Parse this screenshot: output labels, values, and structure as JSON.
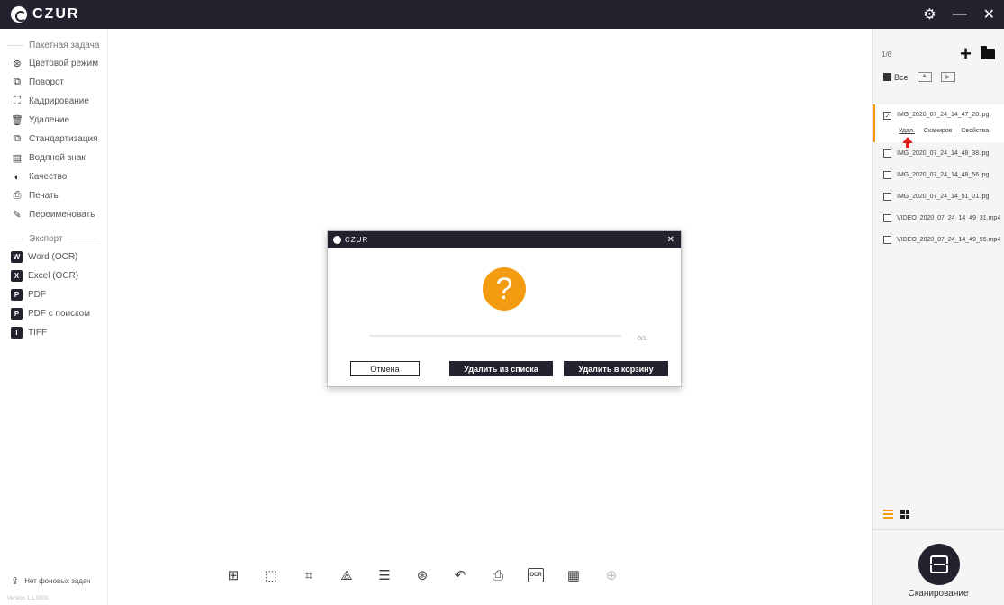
{
  "app": {
    "title": "CZUR"
  },
  "window": {
    "settings_icon": "gear-icon",
    "minimize_icon": "minimize-icon",
    "close_icon": "close-icon"
  },
  "sidebar": {
    "batch_section": "Пакетная задача",
    "batch_items": [
      {
        "label": "Цветовой режим",
        "icon": "color-mode-icon",
        "glyph": "⊛"
      },
      {
        "label": "Поворот",
        "icon": "rotate-icon",
        "glyph": "⧉"
      },
      {
        "label": "Кадрирование",
        "icon": "crop-icon",
        "glyph": "⛶"
      },
      {
        "label": "Удаление",
        "icon": "delete-icon",
        "glyph": "🗑"
      },
      {
        "label": "Стандартизация",
        "icon": "standardize-icon",
        "glyph": "⧉"
      },
      {
        "label": "Водяной знак",
        "icon": "watermark-icon",
        "glyph": "▤"
      },
      {
        "label": "Качество",
        "icon": "quality-icon",
        "glyph": "◐"
      },
      {
        "label": "Печать",
        "icon": "print-icon",
        "glyph": "⎙"
      },
      {
        "label": "Переименовать",
        "icon": "rename-icon",
        "glyph": "✎"
      }
    ],
    "export_section": "Экспорт",
    "export_items": [
      {
        "label": "Word (OCR)",
        "icon": "word-icon",
        "glyph": "W"
      },
      {
        "label": "Excel (OCR)",
        "icon": "excel-icon",
        "glyph": "X"
      },
      {
        "label": "PDF",
        "icon": "pdf-icon",
        "glyph": "P"
      },
      {
        "label": "PDF с поиском",
        "icon": "pdf-search-icon",
        "glyph": "P"
      },
      {
        "label": "TIFF",
        "icon": "tiff-icon",
        "glyph": "T"
      }
    ],
    "background_tasks": "Нет фоновых задач",
    "version": "Version 1.1.0303"
  },
  "toolbar": {
    "buttons": [
      {
        "name": "split-icon",
        "glyph": "⊞"
      },
      {
        "name": "select-area-icon",
        "glyph": "⬚"
      },
      {
        "name": "crop-icon",
        "glyph": "⌗"
      },
      {
        "name": "rotate-crop-icon",
        "glyph": "⟁"
      },
      {
        "name": "adjust-icon",
        "glyph": "☰"
      },
      {
        "name": "color-icon",
        "glyph": "⊛"
      },
      {
        "name": "undo-icon",
        "glyph": "↶"
      },
      {
        "name": "print-icon",
        "glyph": "⎙"
      },
      {
        "name": "ocr-icon",
        "glyph": "OCR"
      },
      {
        "name": "qr-code-icon",
        "glyph": "▦"
      },
      {
        "name": "center-icon",
        "glyph": "⊕",
        "disabled": true
      }
    ]
  },
  "files_panel": {
    "counter": "1/6",
    "filter_all": "Все",
    "files": [
      {
        "name": "IMG_2020_07_24_14_47_20.jpg",
        "checked": true,
        "active": true
      },
      {
        "name": "IMG_2020_07_24_14_48_38.jpg",
        "checked": false
      },
      {
        "name": "IMG_2020_07_24_14_48_56.jpg",
        "checked": false
      },
      {
        "name": "IMG_2020_07_24_14_51_01.jpg",
        "checked": false
      },
      {
        "name": "VIDEO_2020_07_24_14_49_31.mp4",
        "checked": false
      },
      {
        "name": "VIDEO_2020_07_24_14_49_55.mp4",
        "checked": false
      }
    ],
    "file_actions": {
      "delete": "Удал.",
      "scan": "Сканиров",
      "properties": "Свойства"
    },
    "scan_label": "Сканирование"
  },
  "dialog": {
    "title": "CZUR",
    "progress_text": "0/1",
    "progress_fraction": 0,
    "cancel": "Отмена",
    "remove_from_list": "Удалить из списка",
    "move_to_trash": "Удалить в корзину",
    "question_mark": "?"
  },
  "colors": {
    "accent": "#f39c12",
    "dark": "#23232f",
    "arrow": "#e02020"
  }
}
